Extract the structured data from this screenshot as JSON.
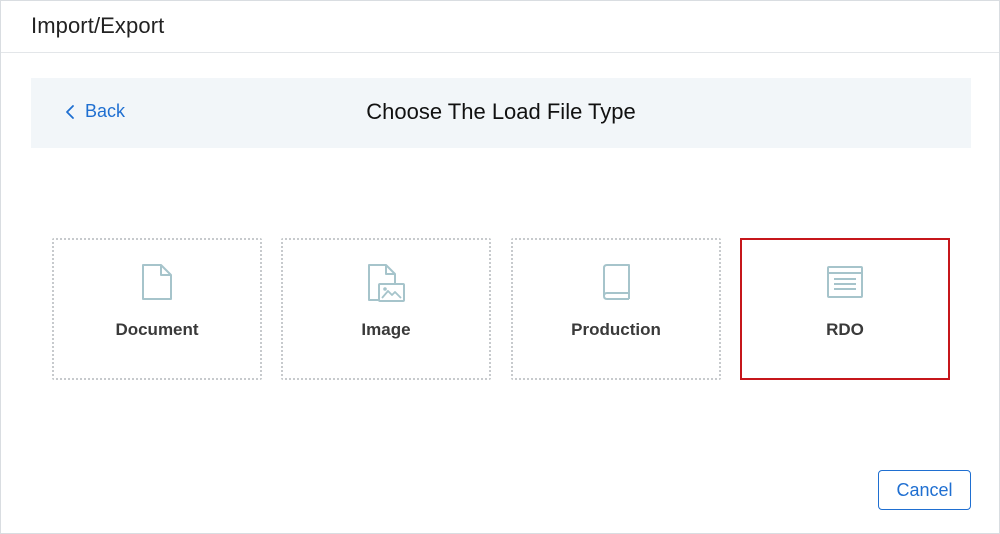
{
  "header": {
    "title": "Import/Export"
  },
  "step_bar": {
    "back_label": "Back",
    "title": "Choose The Load File Type"
  },
  "cards": [
    {
      "label": "Document",
      "icon": "document-icon",
      "selected": false
    },
    {
      "label": "Image",
      "icon": "image-file-icon",
      "selected": false
    },
    {
      "label": "Production",
      "icon": "book-icon",
      "selected": false
    },
    {
      "label": "RDO",
      "icon": "list-window-icon",
      "selected": true
    }
  ],
  "footer": {
    "cancel_label": "Cancel"
  },
  "colors": {
    "accent": "#1f6fd1",
    "selected_border": "#c6161b",
    "icon": "#a6c4cb",
    "step_bar_bg": "#f2f6f9"
  }
}
